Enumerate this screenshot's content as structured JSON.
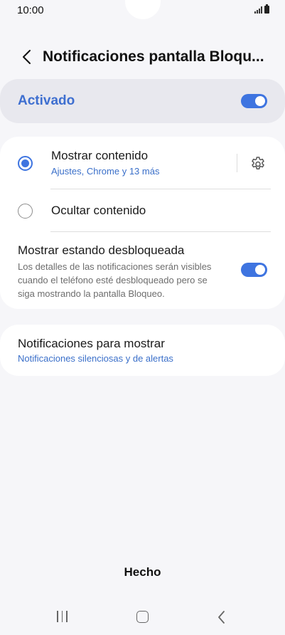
{
  "status_bar": {
    "time": "10:00"
  },
  "header": {
    "title": "Notificaciones pantalla Bloqu..."
  },
  "master": {
    "label": "Activado",
    "enabled": true
  },
  "options": [
    {
      "title": "Mostrar contenido",
      "subtitle": "Ajustes, Chrome y 13 más",
      "selected": true
    },
    {
      "title": "Ocultar contenido",
      "selected": false
    }
  ],
  "show_unlocked": {
    "title": "Mostrar estando desbloqueada",
    "description_lines": [
      "Los detalles de las notificaciones serán visibles",
      "cuando el teléfono esté desbloqueado pero se",
      "siga mostrando la pantalla Bloqueo."
    ],
    "enabled": true
  },
  "notifications_to_show": {
    "title": "Notificaciones para mostrar",
    "subtitle": "Notificaciones silenciosas y de alertas"
  },
  "footer": {
    "done_label": "Hecho"
  },
  "colors": {
    "accent": "#3e74e0",
    "link": "#3a6fc9",
    "background": "#f6f6f9"
  }
}
